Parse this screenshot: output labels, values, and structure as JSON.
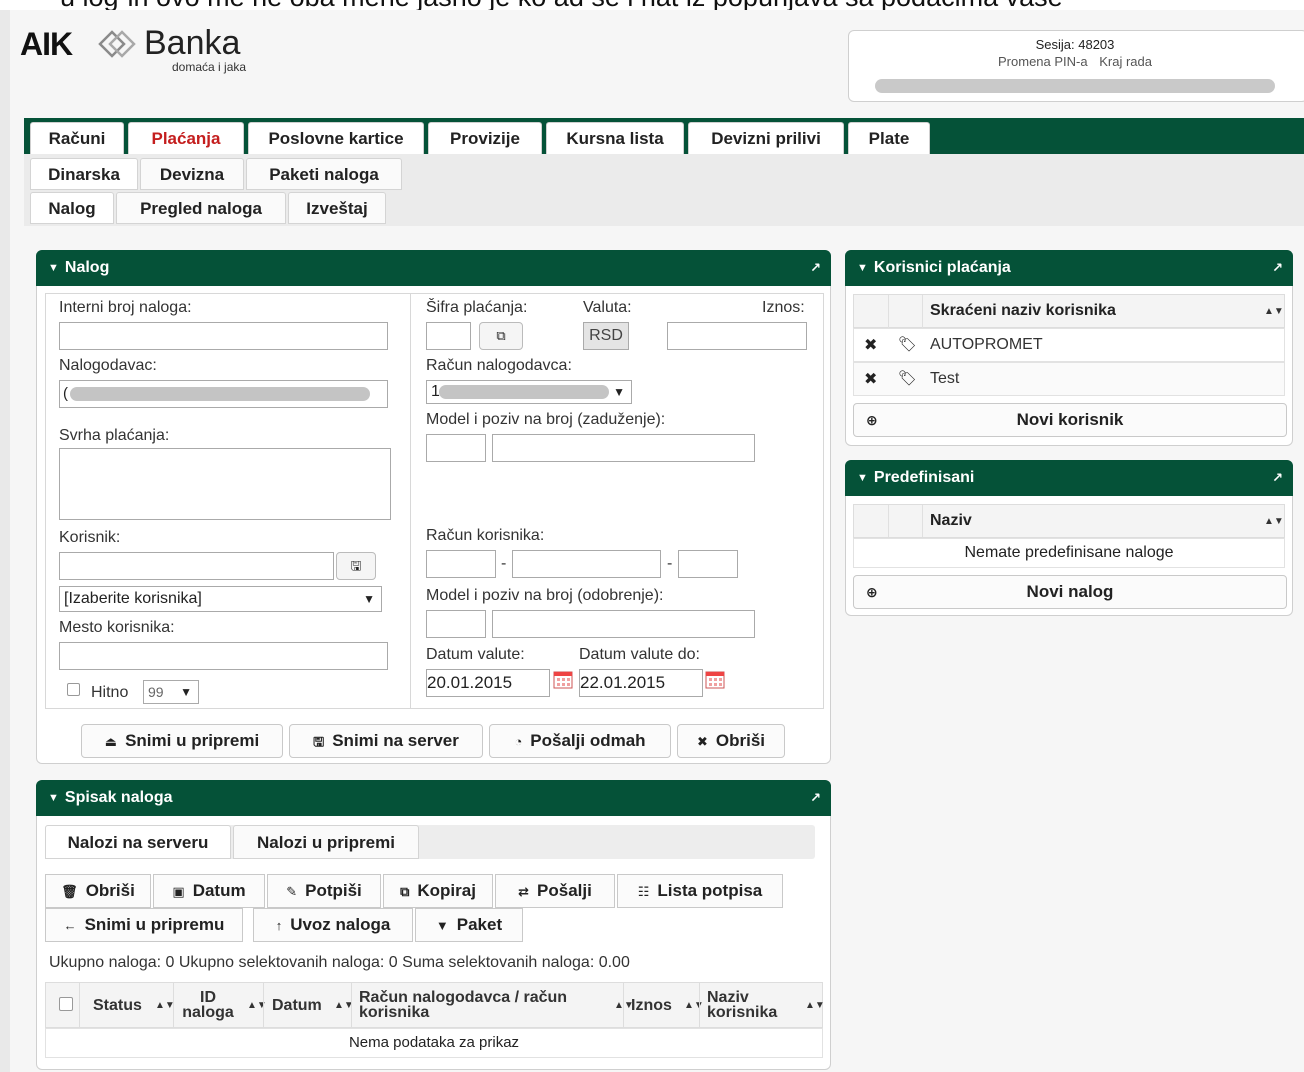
{
  "top_clip_text": "u log-in ovo me ne oba mene jasno je ko ad se i nat iz popunjava sa podacima vase",
  "logo": {
    "brand": "AIK",
    "name": "Banka",
    "tagline": "domaća i jaka"
  },
  "session": {
    "label": "Sesija: 48203",
    "change_pin": "Promena PIN-a",
    "logout": "Kraj rada"
  },
  "tabs": [
    "Računi",
    "Plaćanja",
    "Poslovne kartice",
    "Provizije",
    "Kursna lista",
    "Devizni prilivi",
    "Plate"
  ],
  "subtabs_row1": [
    "Dinarska",
    "Devizna",
    "Paketi naloga"
  ],
  "subtabs_row2": [
    "Nalog",
    "Pregled naloga",
    "Izveštaj"
  ],
  "nalog": {
    "title": "Nalog",
    "interni_broj": "Interni broj naloga:",
    "nalogodavac": "Nalogodavac:",
    "nalogodavac_value": "(",
    "svrha": "Svrha plaćanja:",
    "korisnik": "Korisnik:",
    "korisnik_select": "[Izaberite korisnika]",
    "mesto": "Mesto korisnika:",
    "hitno": "Hitno",
    "hitno_value": "99",
    "sifra": "Šifra plaćanja:",
    "valuta": "Valuta:",
    "valuta_value": "RSD",
    "iznos": "Iznos:",
    "racun_nalogodavca": "Račun nalogodavca:",
    "racun_value": "1",
    "model_zaduzenje": "Model i poziv na broj (zaduženje):",
    "racun_korisnika": "Račun korisnika:",
    "model_odobrenje": "Model i poziv na broj (odobrenje):",
    "datum_valute": "Datum valute:",
    "datum_valute_do": "Datum valute do:",
    "datum_valute_value": "20.01.2015",
    "datum_valute_do_value": "22.01.2015",
    "btn_snimi_pripremi": "Snimi u pripremi",
    "btn_snimi_server": "Snimi na server",
    "btn_posalji": "Pošalji odmah",
    "btn_obrisi": "Obriši"
  },
  "spisak": {
    "title": "Spisak naloga",
    "tab_server": "Nalozi na serveru",
    "tab_priprema": "Nalozi u pripremi",
    "tools_row1": [
      "Obriši",
      "Datum",
      "Potpiši",
      "Kopiraj",
      "Pošalji",
      "Lista potpisa"
    ],
    "tools_row2": [
      "Snimi u pripremu",
      "Uvoz naloga",
      "Paket"
    ],
    "summary": "Ukupno naloga: 0 Ukupno selektovanih naloga: 0 Suma selektovanih naloga: 0.00",
    "columns": [
      "Status",
      "ID naloga",
      "Datum",
      "Račun nalogodavca / račun korisnika",
      "Iznos",
      "Naziv korisnika"
    ],
    "empty": "Nema podataka za prikaz"
  },
  "korisnici": {
    "title": "Korisnici plaćanja",
    "column": "Skraćeni naziv korisnika",
    "rows": [
      "AUTOPROMET",
      "Test"
    ],
    "new_btn": "Novi korisnik"
  },
  "predefinisani": {
    "title": "Predefinisani",
    "column": "Naziv",
    "empty": "Nemate predefinisane naloge",
    "new_btn": "Novi nalog"
  },
  "colors": {
    "brand_green": "#055238",
    "active_tab_red": "#c41e1e"
  }
}
